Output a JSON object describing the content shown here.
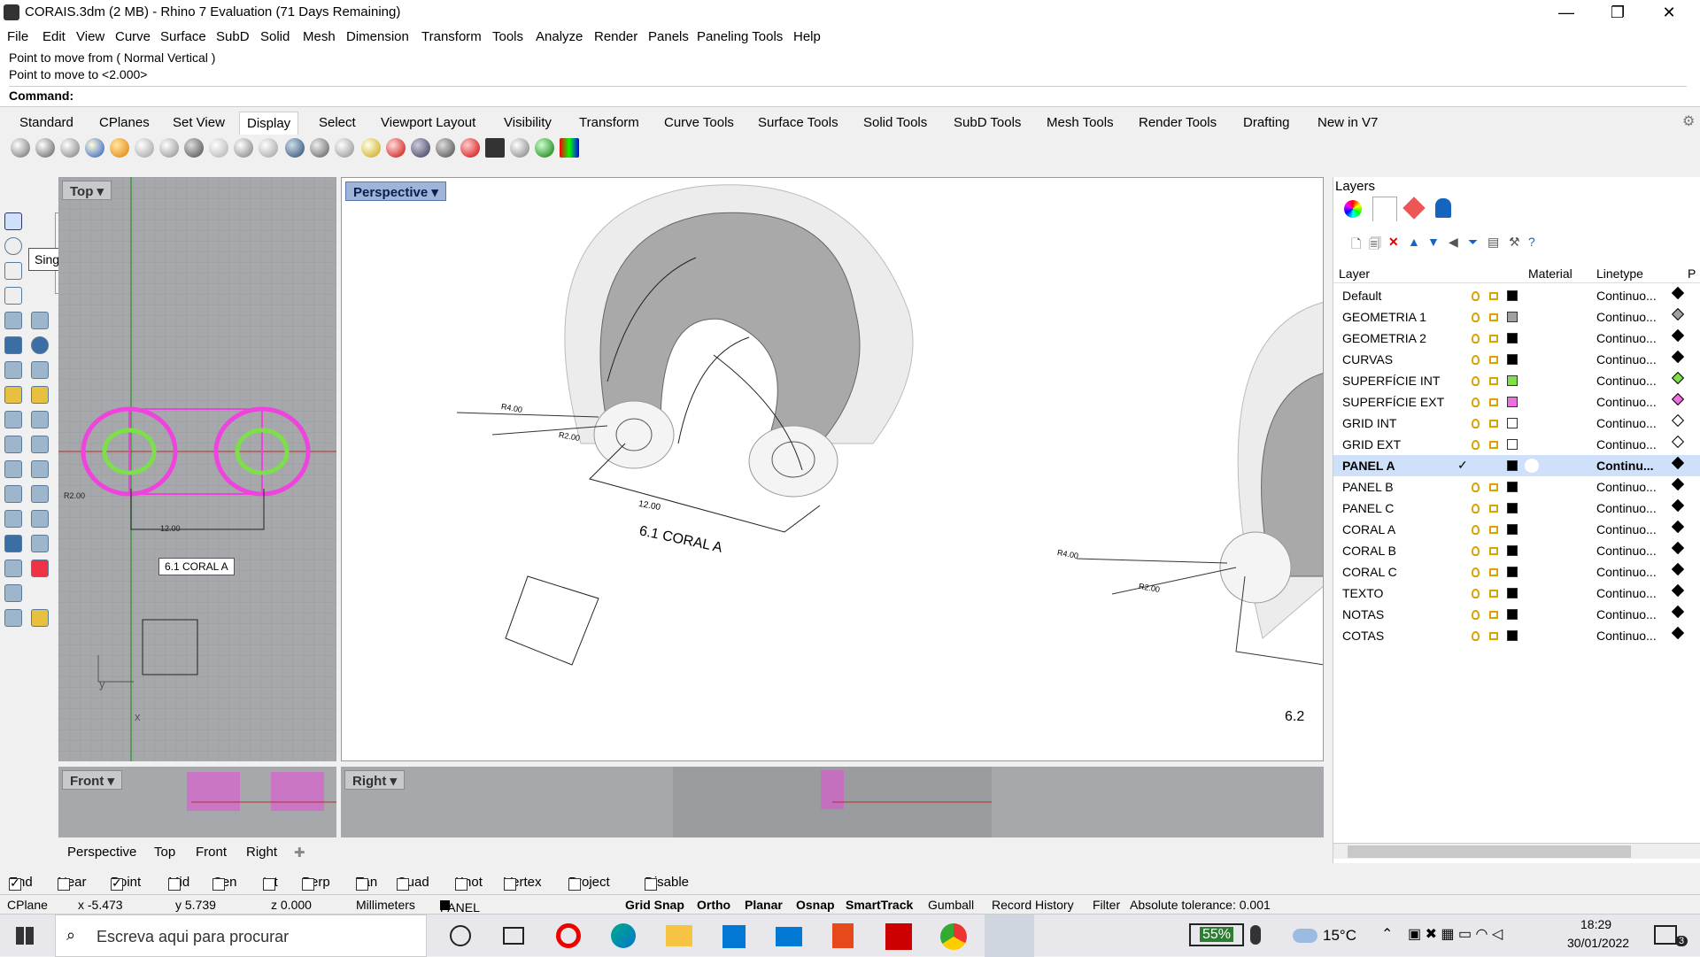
{
  "window": {
    "title": "CORAIS.3dm (2 MB) - Rhino 7 Evaluation (71 Days Remaining)",
    "minimize": "—",
    "restore": "❐",
    "close": "✕"
  },
  "menu": [
    "File",
    "Edit",
    "View",
    "Curve",
    "Surface",
    "SubD",
    "Solid",
    "Mesh",
    "Dimension",
    "Transform",
    "Tools",
    "Analyze",
    "Render",
    "Panels",
    "Paneling Tools",
    "Help"
  ],
  "command": {
    "line1": "Point to move from ( Normal  Vertical )",
    "line2": "Point to move to <2.000>",
    "prompt": "Command:"
  },
  "toolbar_tabs": [
    "Standard",
    "CPlanes",
    "Set View",
    "Display",
    "Select",
    "Viewport Layout",
    "Visibility",
    "Transform",
    "Curve Tools",
    "Surface Tools",
    "Solid Tools",
    "SubD Tools",
    "Mesh Tools",
    "Render Tools",
    "Drafting",
    "New in V7"
  ],
  "tooltip": "Single Line",
  "viewports": {
    "top": {
      "title": "Top",
      "label": "6.1 CORAL A",
      "dim": "12.00",
      "r": "R2.00",
      "y": "y",
      "x": "x"
    },
    "perspective": {
      "title": "Perspective",
      "label1": "6.1 CORAL A",
      "label2": "6.2",
      "dim": "12.00",
      "r4": "R4.00",
      "r2": "R2.00",
      "r4b": "R4.00",
      "r2b": "R2.00"
    },
    "front": {
      "title": "Front"
    },
    "right": {
      "title": "Right"
    }
  },
  "viewport_tabs": [
    "Perspective",
    "Top",
    "Front",
    "Right"
  ],
  "layers": {
    "title": "Layers",
    "columns": {
      "layer": "Layer",
      "material": "Material",
      "linetype": "Linetype",
      "p": "P"
    },
    "rows": [
      {
        "name": "Default",
        "color": "#000000",
        "linetype": "Continuo..."
      },
      {
        "name": "GEOMETRIA 1",
        "color": "#a0a0a0",
        "linetype": "Continuo..."
      },
      {
        "name": "GEOMETRIA 2",
        "color": "#000000",
        "linetype": "Continuo..."
      },
      {
        "name": "CURVAS",
        "color": "#000000",
        "linetype": "Continuo..."
      },
      {
        "name": "SUPERFÍCIE INT",
        "color": "#7de04a",
        "linetype": "Continuo..."
      },
      {
        "name": "SUPERFÍCIE EXT",
        "color": "#f06fe0",
        "linetype": "Continuo..."
      },
      {
        "name": "GRID INT",
        "color": "#ffffff",
        "linetype": "Continuo..."
      },
      {
        "name": "GRID EXT",
        "color": "#ffffff",
        "linetype": "Continuo..."
      },
      {
        "name": "PANEL A",
        "color": "#000000",
        "linetype": "Continu...",
        "selected": true
      },
      {
        "name": "PANEL B",
        "color": "#000000",
        "linetype": "Continuo..."
      },
      {
        "name": "PANEL C",
        "color": "#000000",
        "linetype": "Continuo..."
      },
      {
        "name": "CORAL A",
        "color": "#000000",
        "linetype": "Continuo..."
      },
      {
        "name": "CORAL B",
        "color": "#000000",
        "linetype": "Continuo..."
      },
      {
        "name": "CORAL C",
        "color": "#000000",
        "linetype": "Continuo..."
      },
      {
        "name": "TEXTO",
        "color": "#000000",
        "linetype": "Continuo..."
      },
      {
        "name": "NOTAS",
        "color": "#000000",
        "linetype": "Continuo..."
      },
      {
        "name": "COTAS",
        "color": "#000000",
        "linetype": "Continuo..."
      }
    ]
  },
  "osnap": [
    {
      "label": "End",
      "on": true
    },
    {
      "label": "Near",
      "on": false
    },
    {
      "label": "Point",
      "on": true
    },
    {
      "label": "Mid",
      "on": false
    },
    {
      "label": "Cen",
      "on": false
    },
    {
      "label": "Int",
      "on": false
    },
    {
      "label": "Perp",
      "on": false
    },
    {
      "label": "Tan",
      "on": false
    },
    {
      "label": "Quad",
      "on": false
    },
    {
      "label": "Knot",
      "on": false
    },
    {
      "label": "Vertex",
      "on": false
    },
    {
      "label": "Project",
      "on": false
    },
    {
      "label": "Disable",
      "on": false
    }
  ],
  "status": {
    "cplane": "CPlane",
    "x": "x -5.473",
    "y": "y 5.739",
    "z": "z 0.000",
    "units": "Millimeters",
    "layer": "PANEL A",
    "grid": "Grid Snap",
    "ortho": "Ortho",
    "planar": "Planar",
    "osnap": "Osnap",
    "smarttrack": "SmartTrack",
    "gumball": "Gumball",
    "record": "Record History",
    "filter": "Filter",
    "tolerance": "Absolute tolerance: 0.001"
  },
  "taskbar": {
    "search": "Escreva aqui para procurar",
    "battery": "55%",
    "temp": "15°C",
    "time": "18:29",
    "date": "30/01/2022",
    "notif": "3"
  }
}
